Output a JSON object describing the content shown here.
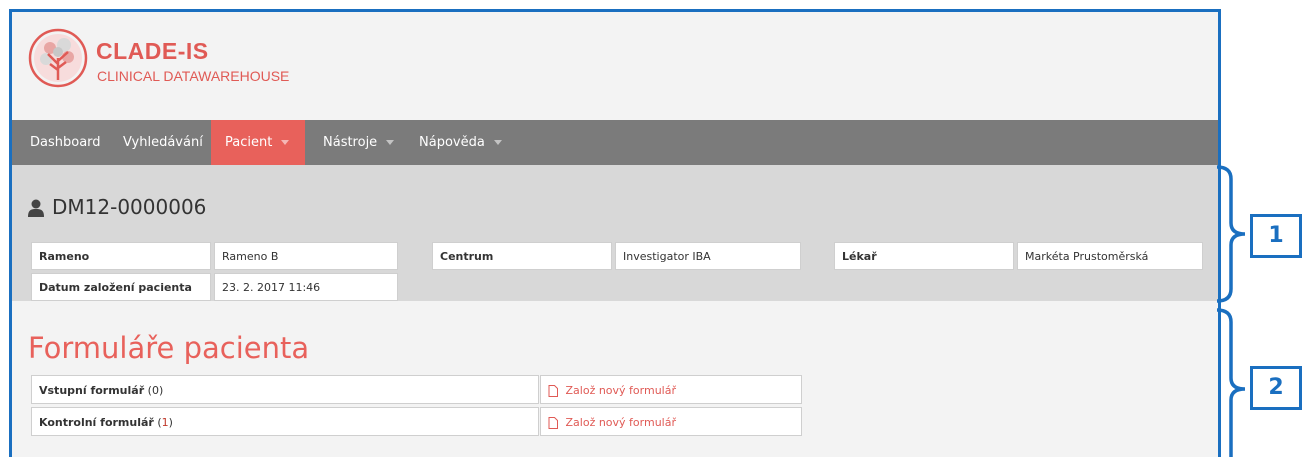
{
  "brand": {
    "title": "CLADE-IS",
    "subtitle": "CLINICAL DATAWAREHOUSE"
  },
  "nav": {
    "items": [
      {
        "label": "Dashboard"
      },
      {
        "label": "Vyhledávání"
      },
      {
        "label": "Pacient"
      },
      {
        "label": "Nástroje"
      },
      {
        "label": "Nápověda"
      }
    ]
  },
  "patient": {
    "id": "DM12-0000006",
    "fields": [
      {
        "label": "Rameno",
        "value": "Rameno B"
      },
      {
        "label": "Centrum",
        "value": "Investigator IBA"
      },
      {
        "label": "Lékař",
        "value": "Markéta Prustoměrská"
      },
      {
        "label": "Datum založení pacienta",
        "value": "23. 2. 2017 11:46"
      }
    ]
  },
  "forms": {
    "title": "Formuláře pacienta",
    "rows": [
      {
        "name": "Vstupní formulář",
        "count_open": "(",
        "count": "0",
        "count_close": ")",
        "action": "Založ nový formulář"
      },
      {
        "name": "Kontrolní formulář",
        "count_open": "(",
        "count": "1",
        "count_close": ")",
        "action": "Založ nový formulář"
      }
    ]
  },
  "callouts": [
    {
      "label": "1"
    },
    {
      "label": "2"
    }
  ],
  "colors": {
    "accent": "#e8615b",
    "nav_bg": "#7b7b7b",
    "callout": "#1a6fc0",
    "patient_bg": "#d8d8d8"
  }
}
